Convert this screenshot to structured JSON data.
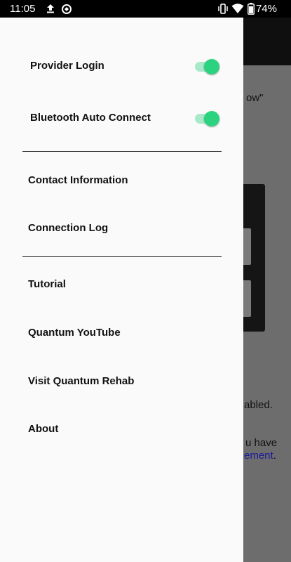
{
  "status_bar": {
    "time": "11:05",
    "battery_percent": "74%",
    "icons": [
      "upload-icon",
      "sync-icon",
      "vibrate-icon",
      "wifi-icon",
      "battery-icon"
    ]
  },
  "background_app": {
    "fragments": {
      "quote_fragment": "ow\"",
      "enabled_fragment": "abled.",
      "have_fragment": "u have",
      "link_fragment": "ement",
      "period": "."
    }
  },
  "drawer": {
    "toggles": [
      {
        "label": "Provider Login",
        "on": true
      },
      {
        "label": "Bluetooth Auto Connect",
        "on": true
      }
    ],
    "menu_group_1": [
      {
        "label": "Contact Information"
      },
      {
        "label": "Connection Log"
      }
    ],
    "menu_group_2": [
      {
        "label": "Tutorial"
      },
      {
        "label": "Quantum YouTube"
      },
      {
        "label": "Visit Quantum Rehab"
      },
      {
        "label": "About"
      }
    ]
  },
  "colors": {
    "switch_knob": "#2bd27f",
    "switch_track": "#a7e9c8",
    "drawer_bg": "#fafafa",
    "scrim": "#6d6d6d",
    "link": "#1a1a9a"
  }
}
